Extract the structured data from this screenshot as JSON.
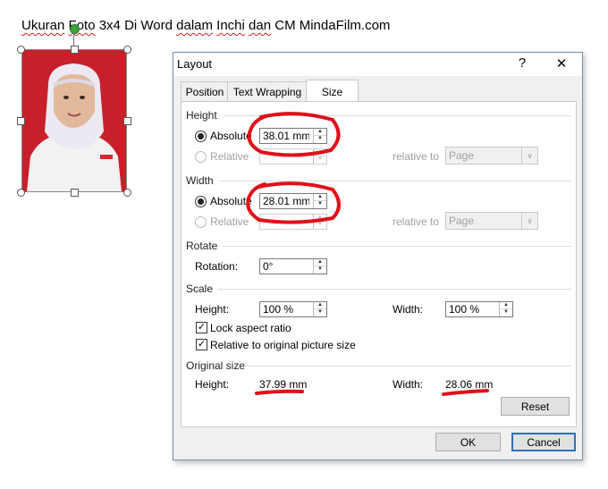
{
  "document": {
    "title_parts": [
      "Ukuran",
      " ",
      "Foto",
      " 3x4 Di Word ",
      "dalam",
      " ",
      "Inchi",
      " ",
      "dan",
      " CM ",
      "MindaFilm.com"
    ]
  },
  "dialog": {
    "title": "Layout",
    "help": "?",
    "close": "✕",
    "tabs": [
      "Position",
      "Text Wrapping",
      "Size"
    ],
    "height_section": "Height",
    "width_section": "Width",
    "rotate_section": "Rotate",
    "scale_section": "Scale",
    "original_section": "Original size",
    "absolute_label": "Absolute",
    "relative_label": "Relative",
    "relative_to_label": "relative to",
    "page_option": "Page",
    "height_absolute_value": "38.01 mm",
    "width_absolute_value": "28.01 mm",
    "rotation_label": "Rotation:",
    "rotation_value": "0°",
    "scale_height_label": "Height:",
    "scale_height_value": "100 %",
    "scale_width_label": "Width:",
    "scale_width_value": "100 %",
    "lock_aspect_label": "Lock aspect ratio",
    "relative_original_label": "Relative to original picture size",
    "original_height_label": "Height:",
    "original_height_value": "37.99 mm",
    "original_width_label": "Width:",
    "original_width_value": "28.06 mm",
    "reset_label": "Reset",
    "ok_label": "OK",
    "cancel_label": "Cancel"
  },
  "colors": {
    "annotation_red": "#e0101a",
    "photo_background": "#c8202a",
    "accent_blue": "#2f6fbf"
  }
}
